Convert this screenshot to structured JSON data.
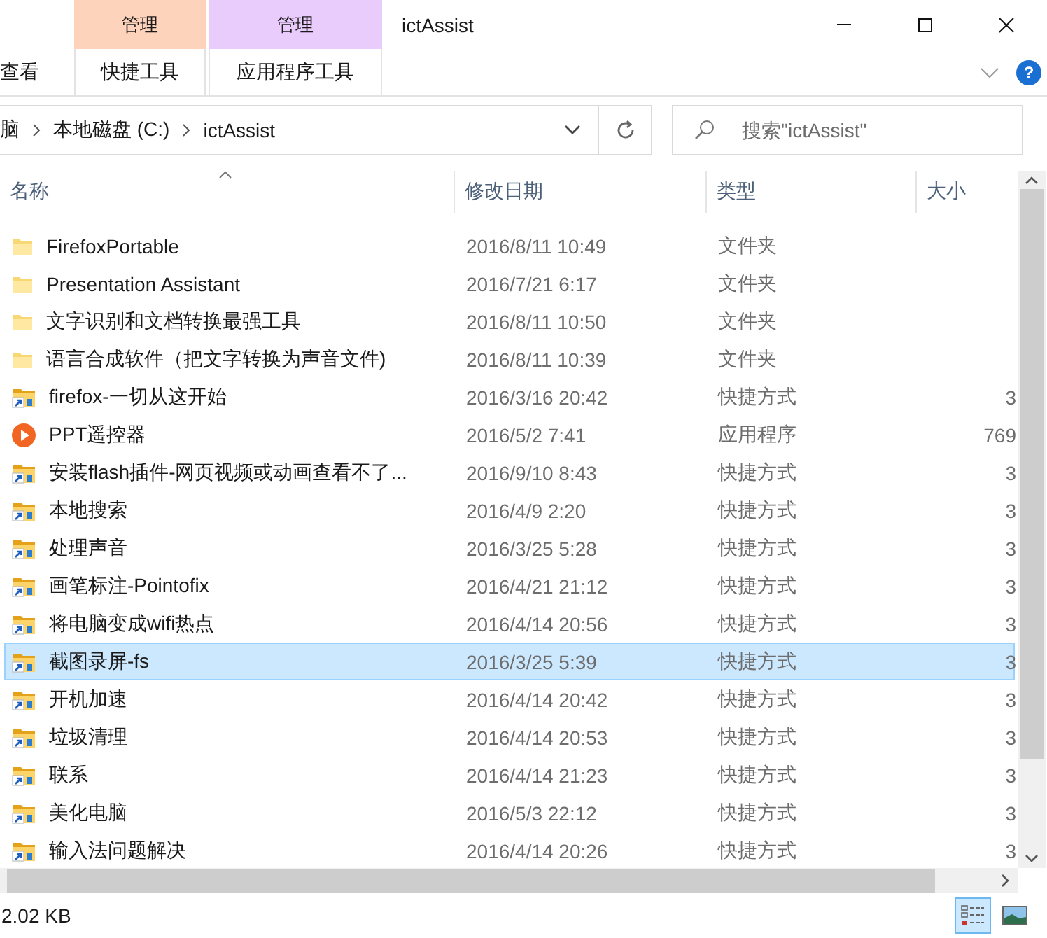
{
  "ribbon": {
    "context_tabs": [
      {
        "header": "管理",
        "label": "快捷工具",
        "color": "#fdd3bc"
      },
      {
        "header": "管理",
        "label": "应用程序工具",
        "color": "#e9ccfb"
      }
    ],
    "view_tab": "查看",
    "title": "ictAssist",
    "help": "?"
  },
  "address": {
    "crumbs": [
      "脑",
      "本地磁盘 (C:)",
      "ictAssist"
    ]
  },
  "search": {
    "placeholder": "搜索\"ictAssist\""
  },
  "columns": [
    "名称",
    "修改日期",
    "类型",
    "大小"
  ],
  "rows": [
    {
      "kind": "folder",
      "name": "FirefoxPortable",
      "date": "2016/8/11 10:49",
      "type": "文件夹",
      "selected": false
    },
    {
      "kind": "folder",
      "name": "Presentation Assistant",
      "date": "2016/7/21 6:17",
      "type": "文件夹",
      "selected": false
    },
    {
      "kind": "folder",
      "name": "文字识别和文档转换最强工具",
      "date": "2016/8/11 10:50",
      "type": "文件夹",
      "selected": false
    },
    {
      "kind": "folder",
      "name": "语言合成软件（把文字转换为声音文件)",
      "date": "2016/8/11 10:39",
      "type": "文件夹",
      "selected": false
    },
    {
      "kind": "shortcut",
      "name": "firefox-一切从这开始",
      "date": "2016/3/16 20:42",
      "type": "快捷方式",
      "size": "3",
      "selected": false
    },
    {
      "kind": "app",
      "name": "PPT遥控器",
      "date": "2016/5/2 7:41",
      "type": "应用程序",
      "size": "769",
      "selected": false
    },
    {
      "kind": "shortcut",
      "name": "安装flash插件-网页视频或动画查看不了...",
      "date": "2016/9/10 8:43",
      "type": "快捷方式",
      "size": "3",
      "selected": false
    },
    {
      "kind": "shortcut",
      "name": "本地搜索",
      "date": "2016/4/9 2:20",
      "type": "快捷方式",
      "size": "3",
      "selected": false
    },
    {
      "kind": "shortcut",
      "name": "处理声音",
      "date": "2016/3/25 5:28",
      "type": "快捷方式",
      "size": "3",
      "selected": false
    },
    {
      "kind": "shortcut",
      "name": "画笔标注-Pointofix",
      "date": "2016/4/21 21:12",
      "type": "快捷方式",
      "size": "3",
      "selected": false
    },
    {
      "kind": "shortcut",
      "name": "将电脑变成wifi热点",
      "date": "2016/4/14 20:56",
      "type": "快捷方式",
      "size": "3",
      "selected": false
    },
    {
      "kind": "shortcut",
      "name": "截图录屏-fs",
      "date": "2016/3/25 5:39",
      "type": "快捷方式",
      "size": "3",
      "selected": true
    },
    {
      "kind": "shortcut",
      "name": "开机加速",
      "date": "2016/4/14 20:42",
      "type": "快捷方式",
      "size": "3",
      "selected": false
    },
    {
      "kind": "shortcut",
      "name": "垃圾清理",
      "date": "2016/4/14 20:53",
      "type": "快捷方式",
      "size": "3",
      "selected": false
    },
    {
      "kind": "shortcut",
      "name": "联系",
      "date": "2016/4/14 21:23",
      "type": "快捷方式",
      "size": "3",
      "selected": false
    },
    {
      "kind": "shortcut",
      "name": "美化电脑",
      "date": "2016/5/3 22:12",
      "type": "快捷方式",
      "size": "3",
      "selected": false
    },
    {
      "kind": "shortcut",
      "name": "输入法问题解决",
      "date": "2016/4/14 20:26",
      "type": "快捷方式",
      "size": "3",
      "selected": false
    }
  ],
  "status": {
    "size": "2.02 KB"
  },
  "views": [
    {
      "kind": "details",
      "selected": true
    },
    {
      "kind": "thumbnails",
      "selected": false
    }
  ]
}
